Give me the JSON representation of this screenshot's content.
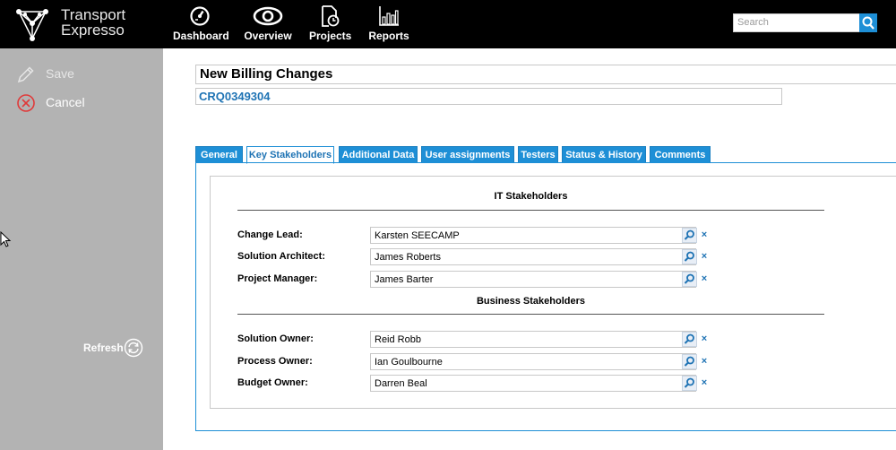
{
  "app": {
    "name_line1": "Transport",
    "name_line2": "Expresso"
  },
  "nav": {
    "items": [
      {
        "label": "Dashboard",
        "icon": "gauge-icon"
      },
      {
        "label": "Overview",
        "icon": "eye-icon"
      },
      {
        "label": "Projects",
        "icon": "document-clock-icon"
      },
      {
        "label": "Reports",
        "icon": "bar-chart-icon"
      }
    ]
  },
  "search": {
    "placeholder": "Search",
    "icon": "search-icon"
  },
  "sidebar": {
    "save_label": "Save",
    "cancel_label": "Cancel",
    "refresh_label": "Refresh"
  },
  "record": {
    "title": "New Billing Changes",
    "code": "CRQ0349304"
  },
  "tabs": [
    {
      "label": "General",
      "active": false
    },
    {
      "label": "Key Stakeholders",
      "active": true
    },
    {
      "label": "Additional Data",
      "active": false
    },
    {
      "label": "User assignments",
      "active": false
    },
    {
      "label": "Testers",
      "active": false
    },
    {
      "label": "Status & History",
      "active": false
    },
    {
      "label": "Comments",
      "active": false
    }
  ],
  "it_section": {
    "title": "IT Stakeholders",
    "fields": [
      {
        "label": "Change Lead:",
        "value": "Karsten SEECAMP"
      },
      {
        "label": "Solution Architect:",
        "value": "James Roberts"
      },
      {
        "label": "Project Manager:",
        "value": "James Barter"
      }
    ]
  },
  "business_section": {
    "title": "Business Stakeholders",
    "fields": [
      {
        "label": "Solution Owner:",
        "value": "Reid Robb"
      },
      {
        "label": "Process Owner:",
        "value": "Ian Goulbourne"
      },
      {
        "label": "Budget Owner:",
        "value": " Darren Beal"
      }
    ]
  },
  "colors": {
    "accent": "#1e8fd6",
    "topbar": "#000000",
    "sidebar": "#b3b3b3",
    "cancel": "#e03a3a"
  },
  "clear_glyph": "×"
}
